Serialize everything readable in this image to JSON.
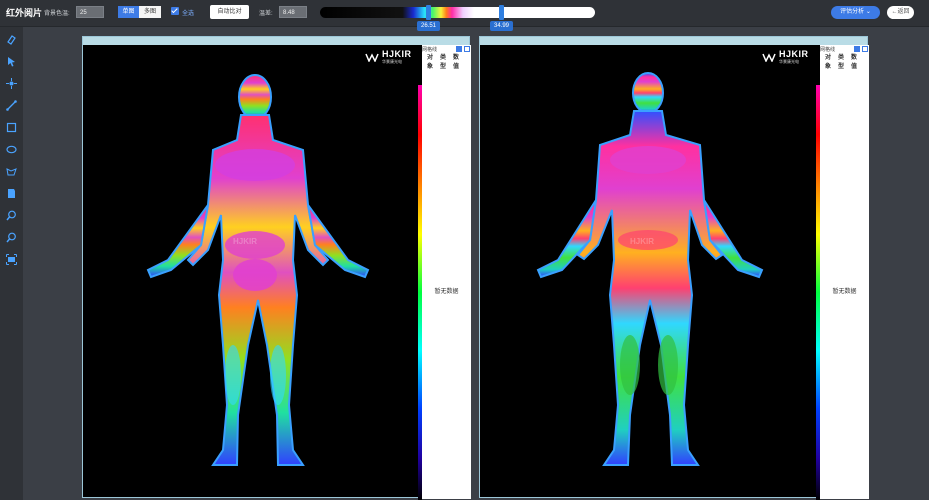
{
  "topbar": {
    "title": "红外阅片",
    "bg_temp_label": "背景色温:",
    "bg_temp_value": "25",
    "mode_single": "单图",
    "mode_multi": "多图",
    "select_all": "全选",
    "auto_compare": "自动比对",
    "temp_diff_label": "温差:",
    "temp_diff_value": "8.48",
    "range_low": "26.51",
    "range_high": "34.99",
    "eval_button": "评估分析",
    "back_button": "返回"
  },
  "tools": [
    "eraser-icon",
    "pointer-icon",
    "point-icon",
    "line-icon",
    "rect-icon",
    "ellipse-icon",
    "polygon-icon",
    "bookmark-icon",
    "zoom-in-icon",
    "zoom-out-icon",
    "fit-icon"
  ],
  "panels": [
    {
      "logo_brand": "HJKIR",
      "logo_sub": "华景康光电",
      "grid_label": "网格线",
      "columns": [
        "对象",
        "类型",
        "数值"
      ],
      "no_data": "暂无数据",
      "watermark": "HJKIR"
    },
    {
      "logo_brand": "HJKIR",
      "logo_sub": "华景康光电",
      "grid_label": "网格线",
      "columns": [
        "对象",
        "类型",
        "数值"
      ],
      "no_data": "暂无数据",
      "watermark": "HJKIR"
    }
  ],
  "colors": {
    "accent": "#3d7be6",
    "toolbar_bg": "#2f3237",
    "workspace_bg": "#3b3f46"
  }
}
